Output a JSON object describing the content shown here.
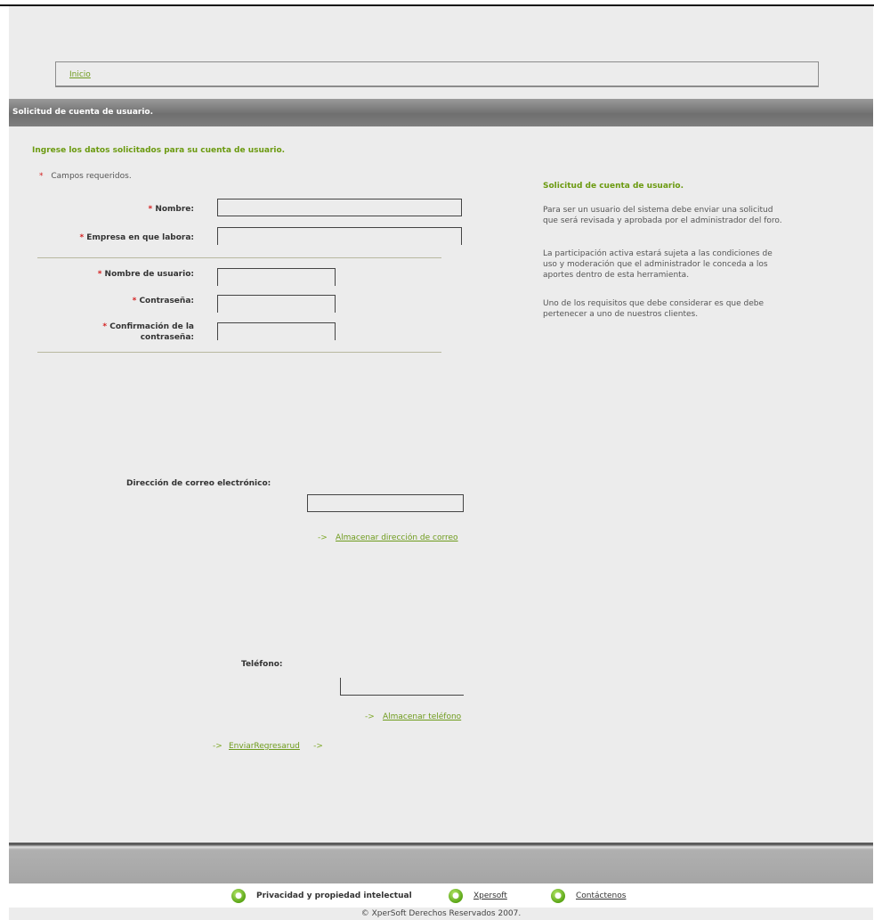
{
  "breadcrumb": {
    "home": "Inicio"
  },
  "header": {
    "title": "Solicitud de cuenta de usuario."
  },
  "form": {
    "intro": "Ingrese los datos solicitados para su cuenta de usuario.",
    "required_mark": "*",
    "required_note": "Campos requeridos.",
    "fields": {
      "nombre": "Nombre:",
      "empresa": "Empresa en que labora:",
      "usuario": "Nombre de usuario:",
      "contrasena": "Contraseña:",
      "confirmacion_1": "Confirmación de la",
      "confirmacion_2": "contraseña:"
    },
    "email_label": "Dirección de correo electrónico:",
    "email_link": "Almacenar dirección de correo",
    "phone_label": "Teléfono:",
    "phone_link": "Almacenar teléfono",
    "submit_link": "EnviarRegresarud",
    "arrow": "->"
  },
  "sidebar": {
    "title": "Solicitud de cuenta de usuario.",
    "p1": "Para ser un usuario del sistema debe enviar una solicitud que será revisada y aprobada por el administrador del foro.",
    "p2": "La participación activa estará sujeta a las condiciones de uso y moderación que el administrador le conceda a los aportes dentro de esta herramienta.",
    "p3": "Uno de los requisitos que debe considerar es que debe pertenecer a uno de nuestros clientes."
  },
  "footer": {
    "privacy": "Privacidad y propiedad intelectual",
    "xpersoft": "Xpersoft",
    "contact": "Contáctenos",
    "copyright": "© XperSoft Derechos Reservados 2007."
  },
  "colors": {
    "accent": "#6b9a10",
    "required": "#d42020",
    "header_bar": "#7e7e7e"
  },
  "icons": {
    "footer": "lock-icon"
  }
}
